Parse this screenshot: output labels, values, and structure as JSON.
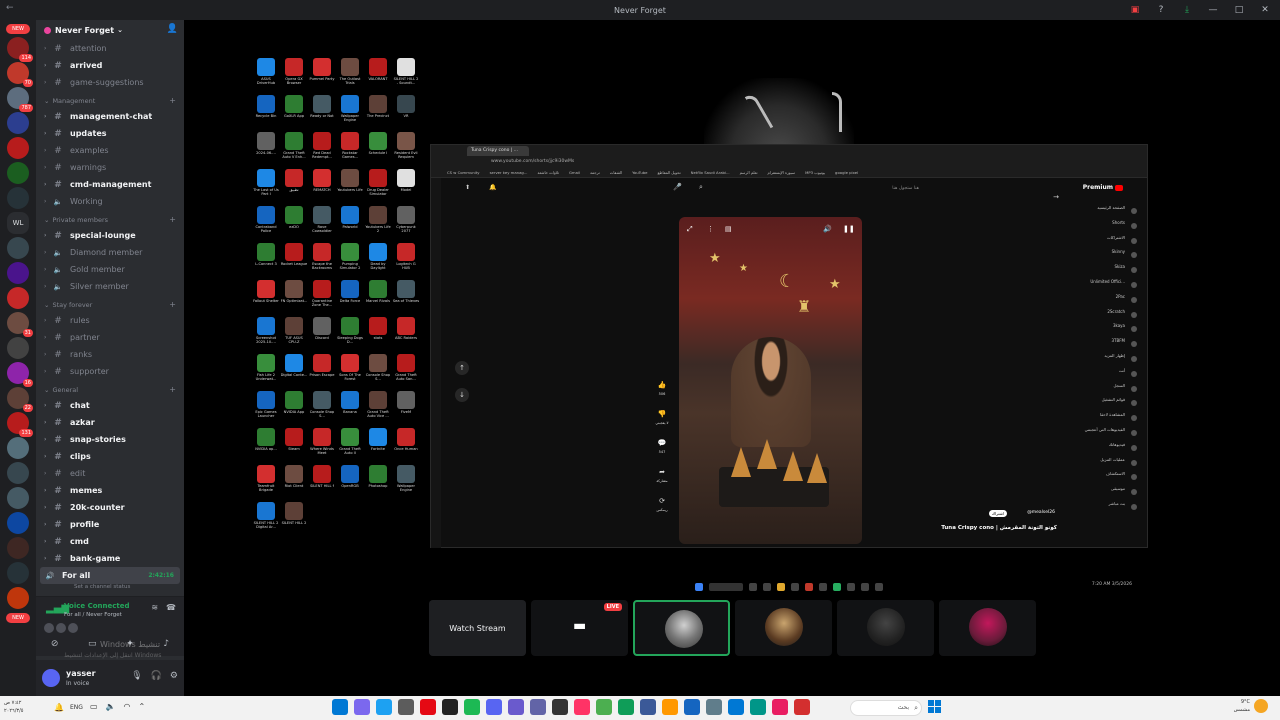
{
  "window": {
    "title": "Never Forget",
    "controls": [
      "minimize",
      "maximize",
      "close"
    ]
  },
  "rail": {
    "new_pill_top": "NEW",
    "new_pill_bottom": "NEW",
    "wl_label": "WL",
    "badges": [
      "114",
      "70",
      "787",
      "31",
      "16",
      "22",
      "131"
    ]
  },
  "guild": {
    "name": "Never Forget"
  },
  "channels": {
    "top": [
      {
        "name": "attention",
        "unread": false
      },
      {
        "name": "arrived",
        "unread": true
      },
      {
        "name": "game-suggestions",
        "unread": false
      }
    ],
    "categories": [
      {
        "name": "Management",
        "items": [
          {
            "name": "management-chat",
            "unread": true,
            "type": "text"
          },
          {
            "name": "updates",
            "unread": true,
            "type": "text"
          },
          {
            "name": "examples",
            "unread": false,
            "type": "text"
          },
          {
            "name": "warnings",
            "unread": false,
            "type": "text"
          },
          {
            "name": "cmd-management",
            "unread": true,
            "type": "text"
          },
          {
            "name": "Working",
            "unread": false,
            "type": "voice"
          }
        ]
      },
      {
        "name": "Private members",
        "items": [
          {
            "name": "special-lounge",
            "unread": true,
            "type": "text"
          },
          {
            "name": "Diamond member",
            "unread": false,
            "type": "voice"
          },
          {
            "name": "Gold member",
            "unread": false,
            "type": "voice"
          },
          {
            "name": "Silver member",
            "unread": false,
            "type": "voice"
          }
        ]
      },
      {
        "name": "Stay forever",
        "items": [
          {
            "name": "rules",
            "unread": false,
            "type": "text"
          },
          {
            "name": "partner",
            "unread": false,
            "type": "text"
          },
          {
            "name": "ranks",
            "unread": false,
            "type": "text"
          },
          {
            "name": "supporter",
            "unread": false,
            "type": "text"
          }
        ]
      },
      {
        "name": "General",
        "items": [
          {
            "name": "chat",
            "unread": true,
            "type": "text"
          },
          {
            "name": "azkar",
            "unread": true,
            "type": "text"
          },
          {
            "name": "snap-stories",
            "unread": true,
            "type": "text"
          },
          {
            "name": "clips",
            "unread": true,
            "type": "text"
          },
          {
            "name": "edit",
            "unread": false,
            "type": "text"
          },
          {
            "name": "memes",
            "unread": true,
            "type": "text"
          },
          {
            "name": "20k-counter",
            "unread": true,
            "type": "text"
          },
          {
            "name": "profile",
            "unread": true,
            "type": "text"
          },
          {
            "name": "cmd",
            "unread": true,
            "type": "text"
          },
          {
            "name": "bank-game",
            "unread": true,
            "type": "text"
          }
        ]
      }
    ],
    "active_voice": {
      "name": "For all",
      "time": "2:42:16",
      "sub": "Set a channel status"
    }
  },
  "voice_panel": {
    "title": "Voice Connected",
    "subtitle": "For all / Never Forget",
    "watermark": "Windows تنشيط",
    "watermark_sub": "انتقل إلى الإعدادات لتنشيط Windows"
  },
  "user": {
    "name": "yasser",
    "status": "In voice"
  },
  "stream": {
    "browser_tab": "Tuna Crispy cono | ...",
    "url": "www.youtube.com/shorts/jjc9i30wMs",
    "bookmarks": [
      "CS w Community",
      "server key manag...",
      "تلاوات خاشعة",
      "Gmail",
      "ترجمة",
      "الشقات",
      "YouTube",
      "تحويل المقاطع",
      "Netflix Saudi Arabi...",
      "تعلم الرسم",
      "سبورة الإنستقرام",
      "MP3 يوتيوب",
      "google pixel"
    ],
    "search_placeholder": "هنا ستجول هنا",
    "premium_label": "Premium",
    "sidebar_items": [
      "الصفحة الرئيسية",
      "Shorts",
      "الاشتراكات",
      "Skinny",
      "Skiza",
      "Unlimited Offici...",
      "2Pac",
      "2Scratch",
      "3kaya",
      "3TBFM",
      "إظهار المزيد",
      "أنت",
      "السجل",
      "قوائم التشغيل",
      "المشاهدة لاحقا",
      "الفيديوهات التي أعجبتني",
      "فيديوهاتك",
      "عمليات التنزيل",
      "الاستكشاف",
      "موسيقى",
      "بث مباشر"
    ],
    "short_title": "Tuna Crispy cono | كونو التونة المقرمش",
    "short_channel": "@mealsel26",
    "short_subscribe": "اشتراك",
    "short_actions": [
      "506",
      "لا يعجبني",
      "547",
      "مشاركة",
      "ريمكس"
    ],
    "tray_time": "7:20 AM",
    "tray_date": "3/5/2026"
  },
  "participants": {
    "watch_stream_label": "Watch Stream",
    "live_label": "LIVE"
  },
  "taskbar": {
    "lang": "ENG",
    "date_left": "٧:٤٢ ص",
    "date_left2": "٢٠٢٦/٣/٥",
    "search_label": "بحث",
    "weather_temp": "9°C",
    "weather_desc": "مشمس"
  },
  "desktop_icons": [
    "ASUS DriverHub",
    "Opera GX Browser",
    "Pummel Party",
    "The Outlast Trials",
    "VALORANT",
    "SILENT HILL 2 - Soundt...",
    "Recycle Bin",
    "GoXLR App",
    "Ready or Not",
    "Wallpaper Engine",
    "The Precinct",
    "VR",
    "2024-06-...",
    "Grand Theft Auto V Enh...",
    "Red Dead Redempt...",
    "Rockstar Games...",
    "Schedule I",
    "Resident Evil Requiem",
    "The Last of Us Part I",
    "تطبيق",
    "REMATCH",
    "Youtubers Life",
    "Drug Dealer Simulator",
    "Model",
    "Contraband Police",
    "ezDO",
    "Rave Cowsoldier",
    "Palworld",
    "Youtubers Life 2",
    "",
    "Cyberpunk 2077",
    "L-Connect 3",
    "Rocket League",
    "Escape the Backrooms",
    "Pumping Simulator 2",
    "",
    "Dead by Daylight",
    "Logitech G HUB",
    "Fallout Shelter",
    "FN Optimizat...",
    "Quarantine Zone The...",
    "",
    "Delta Force",
    "Marvel Rivals",
    "Sea of Thieves",
    "Screenshot 2025-10-...",
    "TUF ASUS CPU-Z",
    "",
    "Discord",
    "Sleeping Dogs D...",
    "stats",
    "ABC Raiders",
    "Fish Life 2 Underwat...",
    "",
    "Digital Conte...",
    "Prison Escape",
    "Sons Of The Forest",
    "Console Shop S...",
    "Grand Theft Auto San...",
    "",
    "Epic Games Launcher",
    "NVIDIA App",
    "Console Shop S...",
    "Banana",
    "Grand Theft Auto Vice ...",
    "",
    "FiveM",
    "NVIDIA ap...",
    "Steam",
    "Where Winds Meet",
    "Grand Theft Auto II",
    "",
    "Fortnite",
    "Once Human",
    "Teamfruit Brigade",
    "Riot Client",
    "SILENT HILL f",
    "",
    "OpenRGB",
    "Photoshop",
    "Wallpaper Engine",
    "SILENT HILL 2 Digital Ar...",
    "SILENT HILL 2",
    ""
  ]
}
